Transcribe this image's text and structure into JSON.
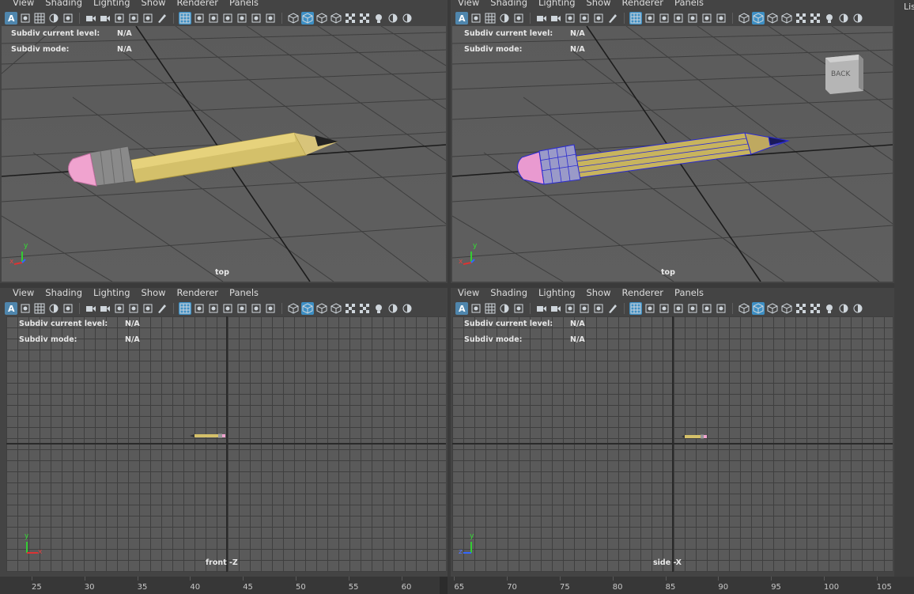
{
  "menu": [
    "View",
    "Shading",
    "Lighting",
    "Show",
    "Renderer",
    "Panels"
  ],
  "hud": {
    "subdiv_level_label": "Subdiv current level:",
    "subdiv_level_value": "N/A",
    "subdiv_mode_label": "Subdiv mode:",
    "subdiv_mode_value": "N/A"
  },
  "panels": {
    "top_left": {
      "camera": "top",
      "shading": "smooth"
    },
    "top_right": {
      "camera": "top",
      "shading": "wireframe-on-shaded",
      "viewcube_label": "BACK"
    },
    "bottom_left": {
      "camera": "front -Z"
    },
    "bottom_right": {
      "camera": "side -X"
    }
  },
  "axis": {
    "x": "x",
    "y": "y",
    "z": "z"
  },
  "timeline": {
    "ticks": [
      "25",
      "30",
      "35",
      "40",
      "45",
      "50",
      "55",
      "60",
      "65",
      "70",
      "75",
      "80",
      "85",
      "90",
      "95",
      "100",
      "105"
    ]
  },
  "side_panel_label": "Lis",
  "colors": {
    "active_icon": "#4f86ad",
    "pencil_body": "#d6c06a",
    "eraser": "#f0a3cf",
    "ferrule": "#8a8a8a",
    "wire": "#2a2ad0"
  }
}
